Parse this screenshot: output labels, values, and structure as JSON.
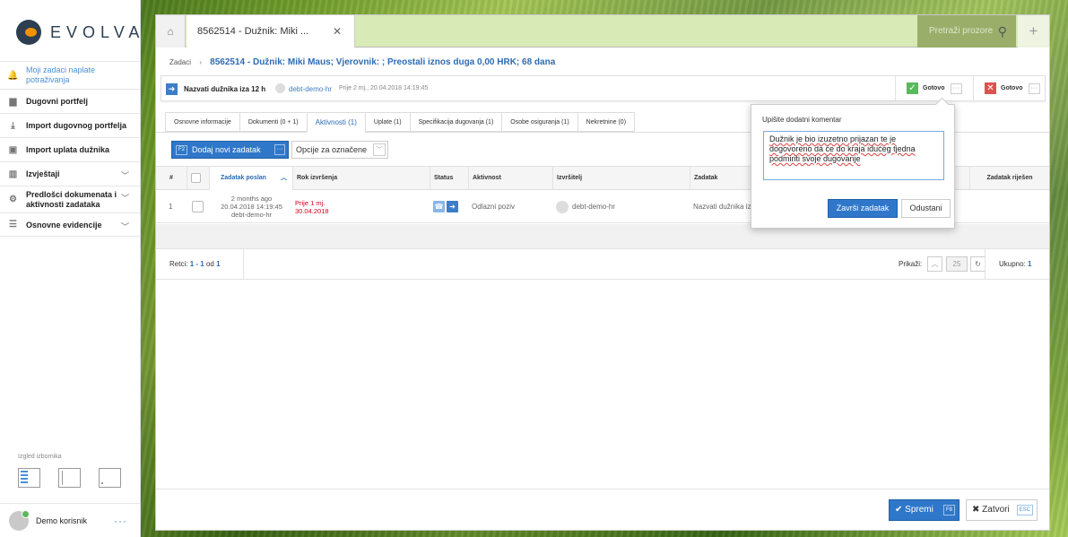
{
  "brand": {
    "name": "EVOLVA"
  },
  "sidebar": {
    "items": [
      {
        "label": "Moji zadaci naplate potraživanja",
        "icon": "bell-icon"
      },
      {
        "label": "Dugovni portfelj",
        "icon": "briefcase-icon"
      },
      {
        "label": "Import dugovnog portfelja",
        "icon": "download-icon"
      },
      {
        "label": "Import uplata dužnika",
        "icon": "money-icon"
      },
      {
        "label": "Izvještaji",
        "icon": "bar-chart-icon"
      },
      {
        "label": "Predlošci dokumenata i aktivnosti zadataka",
        "icon": "gear-icon"
      },
      {
        "label": "Osnovne evidencije",
        "icon": "list-icon"
      }
    ],
    "layout_label": "Izgled izbornika",
    "user": {
      "name": "Demo korisnik",
      "more": "···"
    }
  },
  "window": {
    "tab_title": "8562514 - Dužnik: Miki ...",
    "search_placeholder": "Pretraži prozore",
    "breadcrumb": {
      "root": "Zadaci",
      "current": "8562514 - Dužnik: Miki Maus; Vjerovnik: ; Preostali iznos duga 0,00 HRK; 68 dana"
    },
    "task": {
      "title": "Nazvati dužnika iza 12 h",
      "user": "debt-demo-hr",
      "time": "Prije 2 mj., 20.04.2018 14:19:45",
      "done_label": "Gotovo",
      "fail_label": "Gotovo"
    },
    "tabs": [
      {
        "label": "Osnovne informacije"
      },
      {
        "label": "Dokumenti (0 + 1)"
      },
      {
        "label": "Aktivnosti (1)"
      },
      {
        "label": "Uplate (1)"
      },
      {
        "label": "Specifikacija dugovanja (1)"
      },
      {
        "label": "Osobe osiguranja (1)"
      },
      {
        "label": "Nekretnine (0)"
      }
    ],
    "toolbar": {
      "add_key": "F2",
      "add_label": "Dodaj novi zadatak",
      "options_label": "Opcije za označene"
    },
    "table": {
      "headers": {
        "num": "#",
        "sent": "Zadatak poslan",
        "due": "Rok izvršenja",
        "status": "Status",
        "activity": "Aktivnost",
        "executor": "Izvršitelj",
        "task": "Zadatak",
        "solved": "Zadatak riješen"
      },
      "rows": [
        {
          "num": "1",
          "sent_ago": "2 months ago",
          "sent_date": "20.04.2018 14:19:45",
          "sent_by": "debt-demo-hr",
          "due_rel": "Prije 1 mj.",
          "due_date": "30.04.2018",
          "activity": "Odlazni poziv",
          "executor": "debt-demo-hr",
          "task": "Nazvati dužnika iz"
        }
      ]
    },
    "pager": {
      "rows_label": "Retci:",
      "range": "1 - 1",
      "of": "od",
      "total": "1",
      "show_label": "Prikaži:",
      "page_size": "25",
      "total_label": "Ukupno:",
      "total_value": "1"
    },
    "footer": {
      "save_label": "Spremi",
      "save_key": "F8",
      "close_label": "Zatvori",
      "close_key": "ESC"
    },
    "popover": {
      "label": "Upišite dodatni komentar",
      "comment": "Dužnik je bio izuzetno prijazan te je dogovoreno da će do kraja idućeg tjedna podmiriti svoje dugovanje",
      "finish_label": "Završi zadatak",
      "cancel_label": "Odustani"
    }
  },
  "colors": {
    "accent": "#2f77c9",
    "danger": "#d0021b",
    "success": "#5cb85c"
  }
}
